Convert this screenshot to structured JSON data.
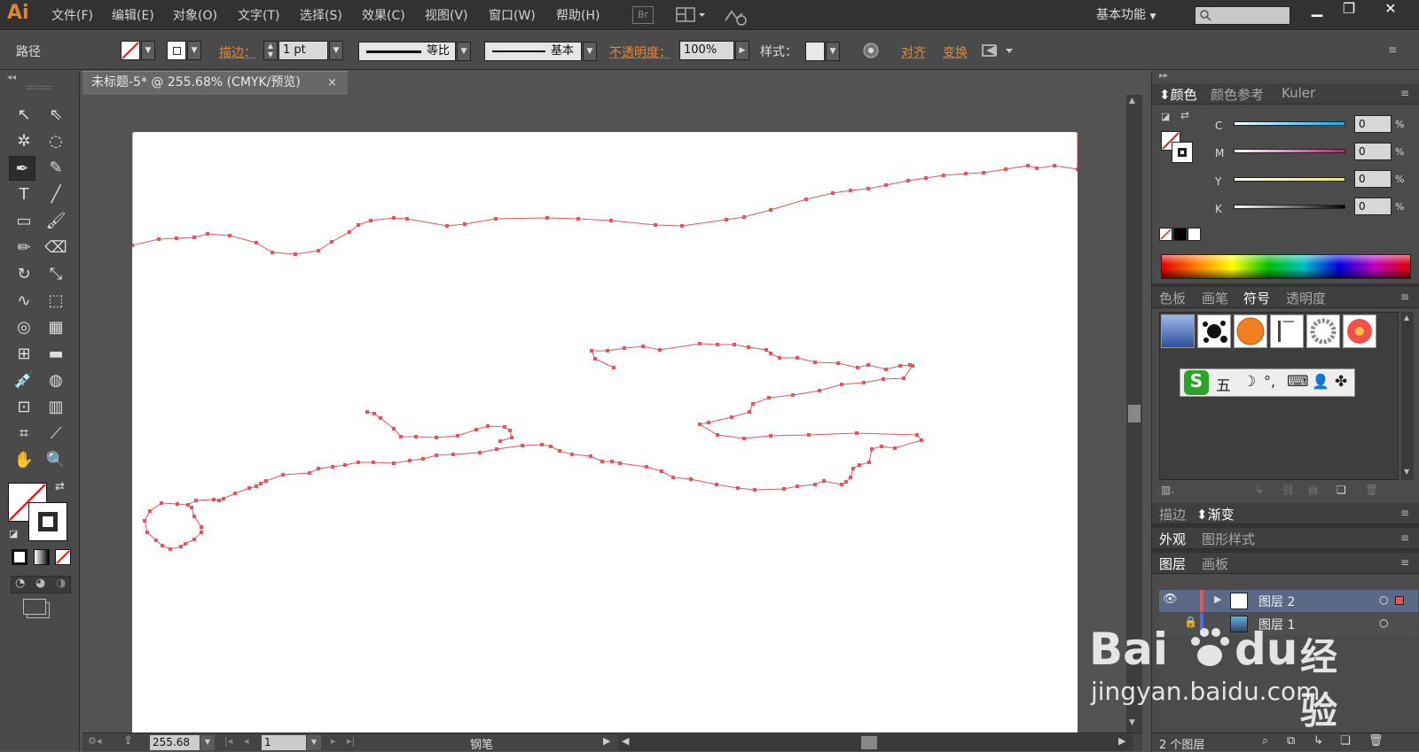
{
  "app": {
    "logo": "Ai",
    "menu": [
      "文件(F)",
      "编辑(E)",
      "对象(O)",
      "文字(T)",
      "选择(S)",
      "效果(C)",
      "视图(V)",
      "窗口(W)",
      "帮助(H)"
    ],
    "bridge_label": "Br",
    "workspace": "基本功能"
  },
  "control_bar": {
    "selection_type": "路径",
    "stroke_label": "描边：",
    "stroke_weight": "1 pt",
    "profile_label": "等比",
    "brush_label": "基本",
    "opacity_label": "不透明度：",
    "opacity_value": "100%",
    "style_label": "样式：",
    "align_label": "对齐",
    "transform_label": "变换"
  },
  "document": {
    "tab_title": "未标题-5* @ 255.68% (CMYK/预览)",
    "close": "×",
    "path_color": "#e8545a"
  },
  "status": {
    "zoom": "255.68",
    "artboard_number": "1",
    "current_tool": "钢笔"
  },
  "color_panel": {
    "tabs": [
      "颜色",
      "颜色参考",
      "Kuler"
    ],
    "channels": [
      {
        "label": "C",
        "value": "0",
        "unit": "%"
      },
      {
        "label": "M",
        "value": "0",
        "unit": "%"
      },
      {
        "label": "Y",
        "value": "0",
        "unit": "%"
      },
      {
        "label": "K",
        "value": "0",
        "unit": "%"
      }
    ]
  },
  "symbols_panel": {
    "tabs": [
      "色板",
      "画笔",
      "符号",
      "透明度"
    ],
    "ime_bar_items": [
      "S",
      "五",
      "☽",
      "°,",
      "⌨",
      "👤",
      "✤"
    ]
  },
  "stroke_panel": {
    "tabs": [
      "描边",
      "渐变"
    ]
  },
  "appearance_panel": {
    "tabs": [
      "外观",
      "图形样式"
    ]
  },
  "layers_panel": {
    "tabs": [
      "图层",
      "画板"
    ],
    "layers": [
      {
        "name": "图层 2",
        "color": "#e8545a"
      },
      {
        "name": "图层 1",
        "color": "#4a6fe0"
      }
    ],
    "footer": "2 个图层"
  },
  "watermark": {
    "brand": "Bai",
    "brand2": "du",
    "cn": "经验",
    "url": "jingyan.baidu.com"
  }
}
